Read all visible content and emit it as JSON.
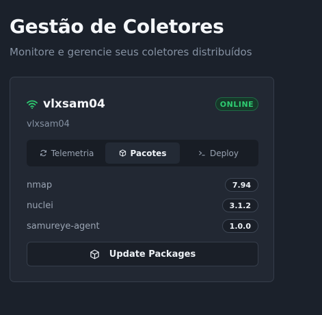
{
  "header": {
    "title": "Gestão de Coletores",
    "subtitle": "Monitore e gerencie seus coletores distribuídos"
  },
  "collector": {
    "name": "vlxsam04",
    "hostname": "vlxsam04",
    "status": "ONLINE",
    "signal_icon": "wifi-icon",
    "status_color": "#2ecc71"
  },
  "tabs": [
    {
      "label": "Telemetria",
      "icon": "refresh-icon",
      "active": false
    },
    {
      "label": "Pacotes",
      "icon": "package-icon",
      "active": true
    },
    {
      "label": "Deploy",
      "icon": "terminal-icon",
      "active": false
    }
  ],
  "packages": [
    {
      "name": "nmap",
      "version": "7.94"
    },
    {
      "name": "nuclei",
      "version": "3.1.2"
    },
    {
      "name": "samureye-agent",
      "version": "1.0.0"
    }
  ],
  "actions": {
    "update_label": "Update Packages",
    "update_icon": "package-icon"
  }
}
